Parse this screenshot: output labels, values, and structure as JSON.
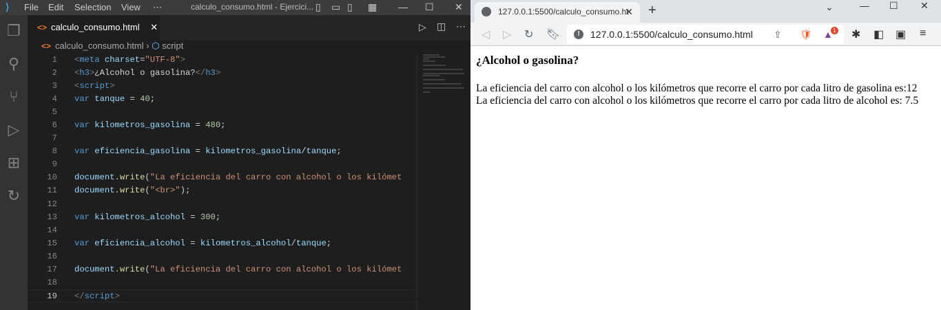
{
  "vscode": {
    "menu": [
      "File",
      "Edit",
      "Selection",
      "View",
      "⋯"
    ],
    "window_title": "calculo_consumo.html - Ejercici...",
    "tab_label": "calculo_consumo.html",
    "breadcrumb": {
      "file": "calculo_consumo.html",
      "symbol": "script"
    },
    "current_line": 19,
    "code": [
      [
        [
          "punct",
          "<"
        ],
        [
          "tag",
          "meta"
        ],
        [
          "txt",
          " "
        ],
        [
          "attr",
          "charset"
        ],
        [
          "txt",
          "="
        ],
        [
          "str",
          "\"UTF-8\""
        ],
        [
          "punct",
          ">"
        ]
      ],
      [
        [
          "punct",
          "<"
        ],
        [
          "tag",
          "h3"
        ],
        [
          "punct",
          ">"
        ],
        [
          "txt",
          "¿Alcohol o gasolina?"
        ],
        [
          "punct",
          "</"
        ],
        [
          "tag",
          "h3"
        ],
        [
          "punct",
          ">"
        ]
      ],
      [
        [
          "punct",
          "<"
        ],
        [
          "tag",
          "script"
        ],
        [
          "punct",
          ">"
        ]
      ],
      [
        [
          "kw",
          "var"
        ],
        [
          "txt",
          " "
        ],
        [
          "var",
          "tanque"
        ],
        [
          "txt",
          " = "
        ],
        [
          "num",
          "40"
        ],
        [
          "txt",
          ";"
        ]
      ],
      [],
      [
        [
          "kw",
          "var"
        ],
        [
          "txt",
          " "
        ],
        [
          "var",
          "kilometros_gasolina"
        ],
        [
          "txt",
          " = "
        ],
        [
          "num",
          "480"
        ],
        [
          "txt",
          ";"
        ]
      ],
      [],
      [
        [
          "kw",
          "var"
        ],
        [
          "txt",
          " "
        ],
        [
          "var",
          "eficiencia_gasolina"
        ],
        [
          "txt",
          " = "
        ],
        [
          "var",
          "kilometros_gasolina"
        ],
        [
          "txt",
          "/"
        ],
        [
          "var",
          "tanque"
        ],
        [
          "txt",
          ";"
        ]
      ],
      [],
      [
        [
          "var",
          "document"
        ],
        [
          "txt",
          "."
        ],
        [
          "fn",
          "write"
        ],
        [
          "txt",
          "("
        ],
        [
          "str",
          "\"La eficiencia del carro con alcohol o los kilómet"
        ]
      ],
      [
        [
          "var",
          "document"
        ],
        [
          "txt",
          "."
        ],
        [
          "fn",
          "write"
        ],
        [
          "txt",
          "("
        ],
        [
          "str",
          "\"<br>\""
        ],
        [
          "txt",
          ");"
        ]
      ],
      [],
      [
        [
          "kw",
          "var"
        ],
        [
          "txt",
          " "
        ],
        [
          "var",
          "kilometros_alcohol"
        ],
        [
          "txt",
          " = "
        ],
        [
          "num",
          "300"
        ],
        [
          "txt",
          ";"
        ]
      ],
      [],
      [
        [
          "kw",
          "var"
        ],
        [
          "txt",
          " "
        ],
        [
          "var",
          "eficiencia_alcohol"
        ],
        [
          "txt",
          " = "
        ],
        [
          "var",
          "kilometros_alcohol"
        ],
        [
          "txt",
          "/"
        ],
        [
          "var",
          "tanque"
        ],
        [
          "txt",
          ";"
        ]
      ],
      [],
      [
        [
          "var",
          "document"
        ],
        [
          "txt",
          "."
        ],
        [
          "fn",
          "write"
        ],
        [
          "txt",
          "("
        ],
        [
          "str",
          "\"La eficiencia del carro con alcohol o los kilómet"
        ]
      ],
      [],
      [
        [
          "punct",
          "</"
        ],
        [
          "tag",
          "script"
        ],
        [
          "punct",
          ">"
        ]
      ]
    ]
  },
  "browser": {
    "tab_title": "127.0.0.1:5500/calculo_consumo.ht",
    "url": "127.0.0.1:5500/calculo_consumo.html",
    "badge_count": "1",
    "page": {
      "heading": "¿Alcohol o gasolina?",
      "lines": [
        "La eficiencia del carro con alcohol o los kilómetros que recorre el carro por cada litro de gasolina es:12",
        "La eficiencia del carro con alcohol o los kilómetros que recorre el carro por cada litro de alcohol es: 7.5"
      ]
    }
  }
}
